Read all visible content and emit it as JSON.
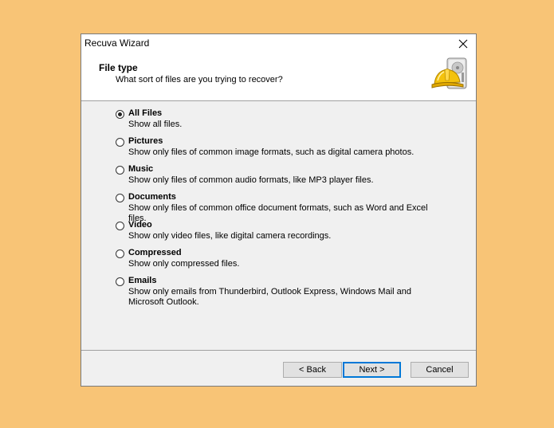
{
  "window": {
    "title": "Recuva Wizard"
  },
  "header": {
    "title": "File type",
    "subtitle": "What sort of files are you trying to recover?",
    "logo_icon": "hard-drive-hardhat-icon"
  },
  "options": [
    {
      "label": "All Files",
      "description": "Show all files.",
      "checked": true
    },
    {
      "label": "Pictures",
      "description": "Show only files of common image formats, such as digital camera photos.",
      "checked": false
    },
    {
      "label": "Music",
      "description": "Show only files of common audio formats, like MP3 player files.",
      "checked": false
    },
    {
      "label": "Documents",
      "description": "Show only files of common office document formats, such as Word and Excel files.",
      "checked": false
    },
    {
      "label": "Video",
      "description": "Show only video files, like digital camera recordings.",
      "checked": false
    },
    {
      "label": "Compressed",
      "description": "Show only compressed files.",
      "checked": false
    },
    {
      "label": "Emails",
      "description": "Show only emails from Thunderbird, Outlook Express, Windows Mail and Microsoft Outlook.",
      "checked": false
    }
  ],
  "buttons": {
    "back": "< Back",
    "next": "Next >",
    "cancel": "Cancel"
  },
  "colors": {
    "desktop": "#f8c476",
    "accent": "#0078d7"
  }
}
